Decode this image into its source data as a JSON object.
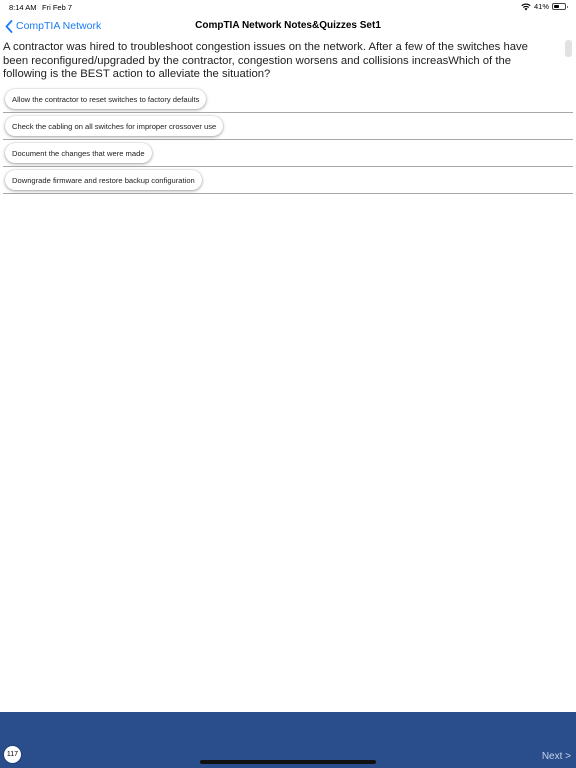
{
  "status_bar": {
    "time": "8:14 AM",
    "date": "Fri Feb 7",
    "battery": "41%"
  },
  "nav": {
    "back_label": "CompTIA Network",
    "title": "CompTIA Network Notes&Quizzes Set1"
  },
  "question": {
    "text": "A contractor was hired to troubleshoot congestion issues on the network. After a few of the switches have been reconfigured/upgraded by the contractor, congestion worsens and collisions increasWhich of the following is the BEST action to alleviate the situation?"
  },
  "answers": [
    {
      "label": "Allow the contractor to reset switches to factory defaults"
    },
    {
      "label": "Check the cabling on all switches for improper crossover use"
    },
    {
      "label": "Document the changes that were made"
    },
    {
      "label": "Downgrade firmware and restore backup configuration"
    }
  ],
  "footer": {
    "page_number": "117",
    "next_label": "Next >",
    "background_color": "#2a4d8b"
  },
  "colors": {
    "accent": "#1a7cf5"
  }
}
